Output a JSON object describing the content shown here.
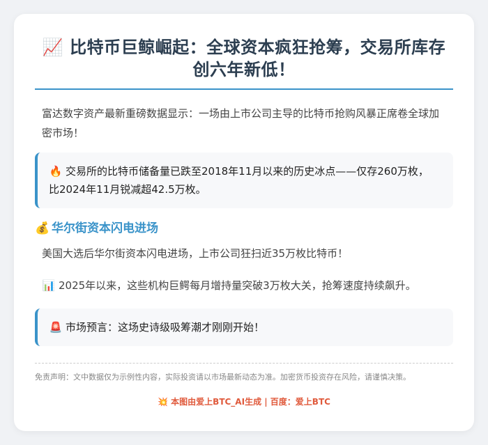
{
  "article": {
    "title_icon": "📈",
    "title": "比特币巨鲸崛起：全球资本疯狂抢筹，交易所库存创六年新低！",
    "intro": "富达数字资产最新重磅数据显示：一场由上市公司主导的比特币抢购风暴正席卷全球加密市场！",
    "reserve_callout": {
      "icon": "🔥",
      "text": "交易所的比特币储备量已跌至2018年11月以来的历史冰点——仅存260万枚，比2024年11月锐减超42.5万枚。"
    },
    "section": {
      "icon": "💰",
      "heading": "华尔街资本闪电进场",
      "paragraph": "美国大选后华尔街资本闪电进场，上市公司狂扫近35万枚比特币！"
    },
    "growth": {
      "icon": "📊",
      "text": "2025年以来，这些机构巨鳄每月增持量突破3万枚大关，抢筹速度持续飙升。"
    },
    "forecast_callout": {
      "icon": "🚨",
      "text": "市场预言：这场史诗级吸筹潮才刚刚开始！"
    },
    "disclaimer": "免责声明：文中数据仅为示例性内容，实际投资请以市场最新动态为准。加密货币投资存在风险，请谨慎决策。",
    "credit": {
      "icon": "💥",
      "text": "本图由爱上BTC_AI生成 | 百度：爱上BTC"
    }
  },
  "colors": {
    "accent": "#3a93c9",
    "title": "#2c3e50",
    "credit": "#e05a3c",
    "background": "#f0f2f5",
    "card": "#ffffff"
  }
}
